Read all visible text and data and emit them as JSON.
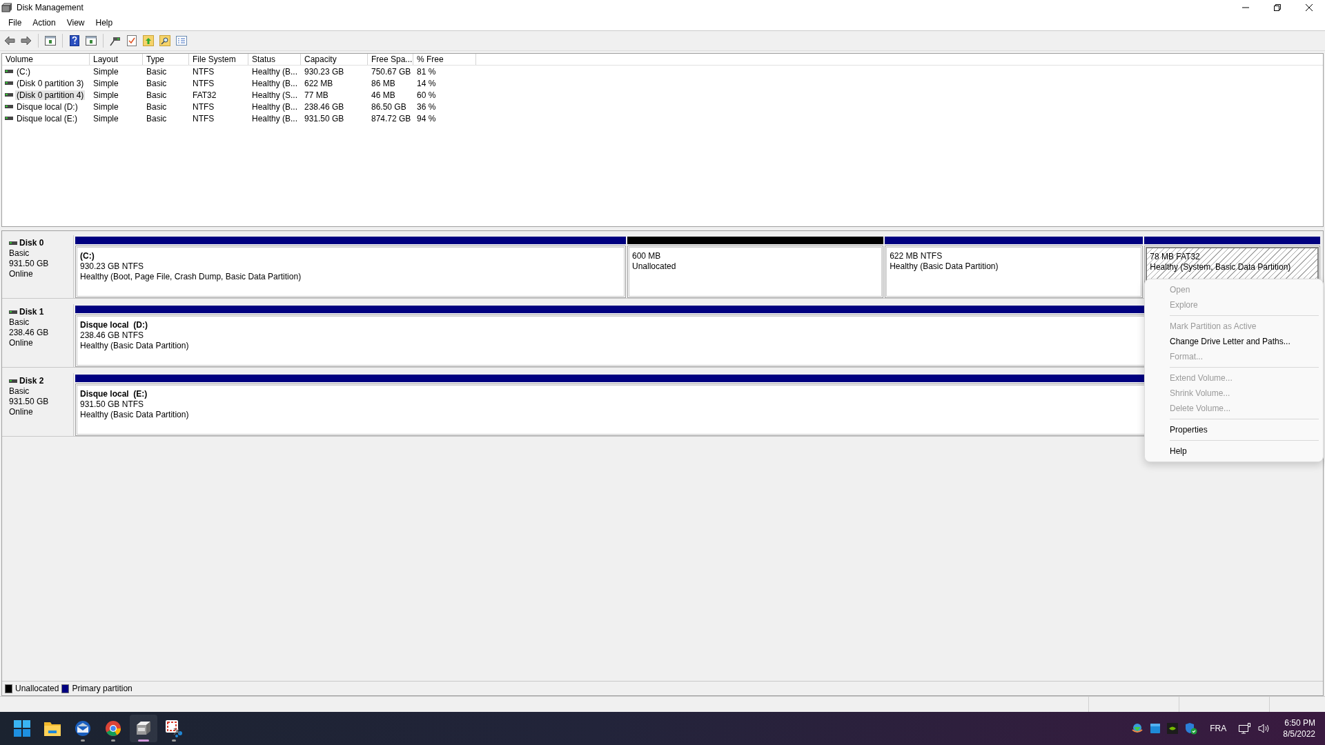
{
  "window": {
    "title": "Disk Management"
  },
  "menu": [
    "File",
    "Action",
    "View",
    "Help"
  ],
  "table": {
    "columns": [
      "Volume",
      "Layout",
      "Type",
      "File System",
      "Status",
      "Capacity",
      "Free Spa...",
      "% Free"
    ],
    "rows": [
      {
        "selected": false,
        "cells": [
          "(C:)",
          "Simple",
          "Basic",
          "NTFS",
          "Healthy (B...",
          "930.23 GB",
          "750.67 GB",
          "81 %"
        ]
      },
      {
        "selected": false,
        "cells": [
          "(Disk 0 partition 3)",
          "Simple",
          "Basic",
          "NTFS",
          "Healthy (B...",
          "622 MB",
          "86 MB",
          "14 %"
        ]
      },
      {
        "selected": true,
        "cells": [
          "(Disk 0 partition 4)",
          "Simple",
          "Basic",
          "FAT32",
          "Healthy (S...",
          "77 MB",
          "46 MB",
          "60 %"
        ]
      },
      {
        "selected": false,
        "cells": [
          "Disque local (D:)",
          "Simple",
          "Basic",
          "NTFS",
          "Healthy (B...",
          "238.46 GB",
          "86.50 GB",
          "36 %"
        ]
      },
      {
        "selected": false,
        "cells": [
          "Disque local (E:)",
          "Simple",
          "Basic",
          "NTFS",
          "Healthy (B...",
          "931.50 GB",
          "874.72 GB",
          "94 %"
        ]
      }
    ]
  },
  "disks": [
    {
      "name": "Disk 0",
      "type": "Basic",
      "size": "931.50 GB",
      "status": "Online",
      "partitions": [
        {
          "kind": "primary",
          "selected": false,
          "title": "(C:)",
          "size": "930.23 GB NTFS",
          "status": "Healthy (Boot, Page File, Crash Dump, Basic Data Partition)"
        },
        {
          "kind": "unallocated",
          "selected": false,
          "size": "600 MB",
          "status": "Unallocated"
        },
        {
          "kind": "primary",
          "selected": false,
          "size": "622 MB NTFS",
          "status": "Healthy (Basic Data Partition)"
        },
        {
          "kind": "primary",
          "selected": true,
          "size": "78 MB FAT32",
          "status": "Healthy (System, Basic Data Partition)"
        }
      ]
    },
    {
      "name": "Disk 1",
      "type": "Basic",
      "size": "238.46 GB",
      "status": "Online",
      "partitions": [
        {
          "kind": "primary",
          "selected": false,
          "title": "Disque local  (D:)",
          "size": "238.46 GB NTFS",
          "status": "Healthy (Basic Data Partition)"
        }
      ]
    },
    {
      "name": "Disk 2",
      "type": "Basic",
      "size": "931.50 GB",
      "status": "Online",
      "partitions": [
        {
          "kind": "primary",
          "selected": false,
          "title": "Disque local  (E:)",
          "size": "931.50 GB NTFS",
          "status": "Healthy (Basic Data Partition)"
        }
      ]
    }
  ],
  "legend": [
    {
      "label": "Unallocated",
      "color": "#000000"
    },
    {
      "label": "Primary partition",
      "color": "#000080"
    }
  ],
  "context_menu": {
    "groups": [
      [
        {
          "label": "Open",
          "disabled": true
        },
        {
          "label": "Explore",
          "disabled": true
        }
      ],
      [
        {
          "label": "Mark Partition as Active",
          "disabled": true
        },
        {
          "label": "Change Drive Letter and Paths...",
          "disabled": false
        },
        {
          "label": "Format...",
          "disabled": true
        }
      ],
      [
        {
          "label": "Extend Volume...",
          "disabled": true
        },
        {
          "label": "Shrink Volume...",
          "disabled": true
        },
        {
          "label": "Delete Volume...",
          "disabled": true
        }
      ],
      [
        {
          "label": "Properties",
          "disabled": false
        }
      ],
      [
        {
          "label": "Help",
          "disabled": false
        }
      ]
    ]
  },
  "taskbar": {
    "apps": [
      {
        "kind": "start",
        "active": false,
        "running": false
      },
      {
        "kind": "folder",
        "active": false,
        "running": false
      },
      {
        "kind": "mail",
        "active": false,
        "running": true
      },
      {
        "kind": "browser",
        "active": false,
        "running": true
      },
      {
        "kind": "disk",
        "active": true,
        "running": true
      },
      {
        "kind": "snip",
        "active": false,
        "running": true
      }
    ],
    "language": "FRA",
    "time": "6:50 PM",
    "date": "8/5/2022"
  }
}
